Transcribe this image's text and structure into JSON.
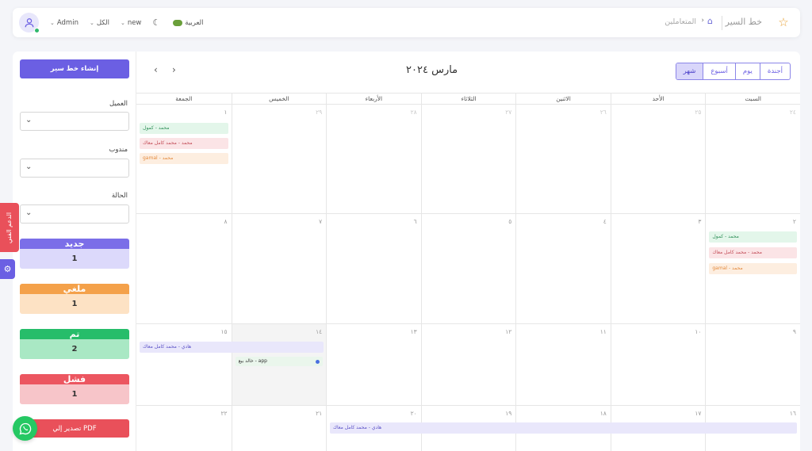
{
  "topbar": {
    "title": "خط السير",
    "breadcrumb": "المتعاملين",
    "user": "Admin",
    "all_label": "الكل",
    "new_label": "new",
    "language": "العربية"
  },
  "sidebar": {
    "create_button": "إنشاء خط سير",
    "filters": [
      {
        "label": "العميل",
        "value": ""
      },
      {
        "label": "مندوب",
        "value": ""
      },
      {
        "label": "الحالة",
        "value": ""
      }
    ],
    "statuses": [
      {
        "label": "جديد",
        "count": "1",
        "head_color": "#7b6ee8",
        "body_color": "#dcd9fb"
      },
      {
        "label": "ملغي",
        "count": "1",
        "head_color": "#f4a14a",
        "body_color": "#fde2c4"
      },
      {
        "label": "تم",
        "count": "2",
        "head_color": "#26bd6a",
        "body_color": "#a9e8c4"
      },
      {
        "label": "فشل",
        "count": "1",
        "head_color": "#ec5660",
        "body_color": "#f7c5c9"
      }
    ],
    "pdf_button": "تصدير إلي PDF"
  },
  "calendar": {
    "title": "مارس ٢٠٢٤",
    "views": [
      "أجندة",
      "يوم",
      "أسبوع",
      "شهر"
    ],
    "active_view": "شهر",
    "weekdays": [
      "الجمعة",
      "الخميس",
      "الأربعاء",
      "الثلاثاء",
      "الاثنين",
      "الأحد",
      "السبت"
    ],
    "weeks": [
      [
        "١",
        "٢٩",
        "٢٨",
        "٢٧",
        "٢٦",
        "٢٥",
        "٢٤"
      ],
      [
        "٨",
        "٧",
        "٦",
        "٥",
        "٤",
        "٣",
        "٢"
      ],
      [
        "١٥",
        "١٤",
        "١٣",
        "١٢",
        "١١",
        "١٠",
        "٩"
      ],
      [
        "٢٢",
        "٢١",
        "٢٠",
        "١٩",
        "١٨",
        "١٧",
        "١٦"
      ]
    ],
    "events": {
      "green": "محمد - كمول",
      "red": "محمد - محمد كامل معاك",
      "orange": "gamal - محمد",
      "purple": "هادي - محمد كامل معاك",
      "app": "خالد بيع - app"
    }
  },
  "floating": {
    "support": "الدعم الفني"
  }
}
